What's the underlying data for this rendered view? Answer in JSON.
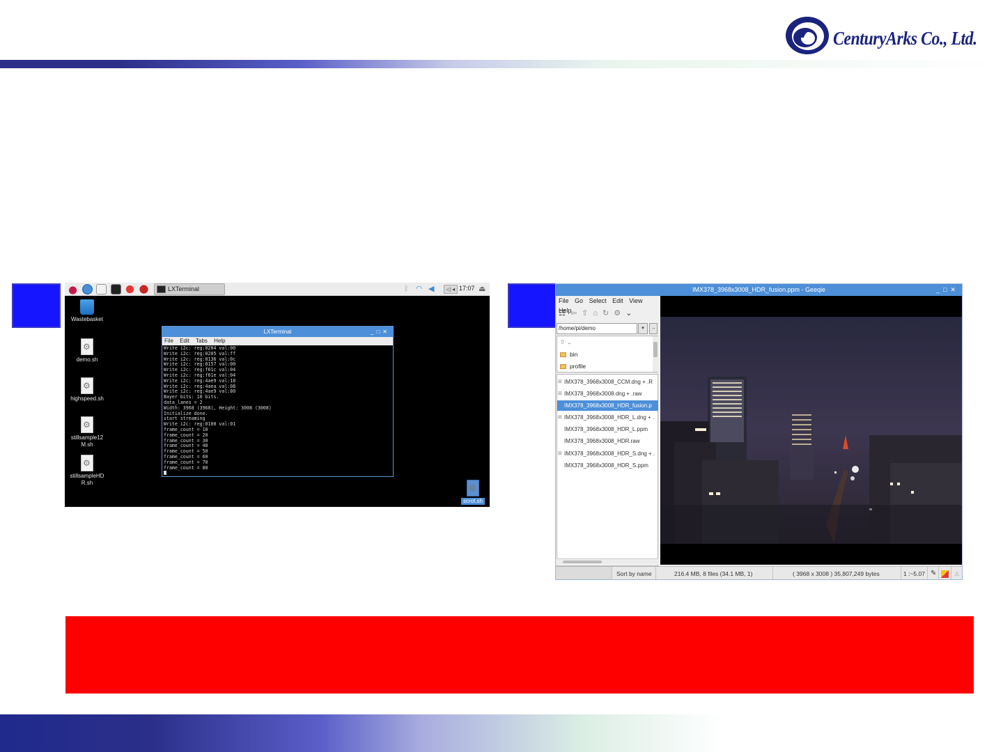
{
  "header": {
    "company": "CenturyArks Co., Ltd."
  },
  "left_screen": {
    "panel": {
      "task_label": "LXTerminal",
      "clock": "17:07",
      "tray_box": "◁ ◂"
    },
    "desktop_icons": [
      {
        "label": "Wastebasket"
      },
      {
        "label": "demo.sh"
      },
      {
        "label": "highspeed.sh"
      },
      {
        "label": "stillsample12\nM.sh"
      },
      {
        "label": "stillsampleHD\nR.sh"
      },
      {
        "label": "scrot.sh"
      }
    ],
    "terminal": {
      "title": "LXTerminal",
      "menu": [
        "File",
        "Edit",
        "Tabs",
        "Help"
      ],
      "output": "Write i2c: reg:0204 val:00\nWrite i2c: reg:0205 val:ff\nWrite i2c: reg:0136 val:0c\nWrite i2c: reg:0157 val:00\nWrite i2c: reg:f61c val:04\nWrite i2c: reg:f61e val:04\nWrite i2c: reg:4ae9 val:18\nWrite i2c: reg:4aea val:08\nWrite i2c: reg:4ae9 val:80\nBayer bits: 10 bits.\ndata_lanes = 2\nWidth: 3968 (3968), Height: 3008 (3008)\nInitialize done.\nstart streaming\nWrite i2c: reg:0100 val:01\nframe_count = 10\nframe_count = 20\nframe_count = 30\nframe_count = 40\nframe_count = 50\nframe_count = 60\nframe_count = 70\nframe_count = 80"
    }
  },
  "right_screen": {
    "title": "IMX378_3968x3008_HDR_fusion.ppm - Geeqie",
    "menu": [
      "File",
      "Go",
      "Select",
      "Edit",
      "View",
      "Help"
    ],
    "path": "/home/pi/demo",
    "dirs": [
      "..",
      "bin",
      "profile"
    ],
    "files": [
      {
        "name": "IMX378_3968x3008_CCM.dng + .R",
        "expander": true,
        "selected": false
      },
      {
        "name": "IMX378_3968x3008.dng + .raw",
        "expander": true,
        "selected": false
      },
      {
        "name": "IMX378_3968x3008_HDR_fusion.p",
        "expander": false,
        "selected": true
      },
      {
        "name": "IMX378_3968x3008_HDR_L.dng + .",
        "expander": true,
        "selected": false
      },
      {
        "name": "IMX378_3968x3008_HDR_L.ppm",
        "expander": false,
        "selected": false
      },
      {
        "name": "IMX378_3968x3008_HDR.raw",
        "expander": false,
        "selected": false
      },
      {
        "name": "IMX378_3968x3008_HDR_S.dng + .",
        "expander": true,
        "selected": false
      },
      {
        "name": "IMX378_3968x3008_HDR_S.ppm",
        "expander": false,
        "selected": false
      }
    ],
    "status": {
      "sort": "Sort by name",
      "summary": "216.4 MB, 8 files (34.1 MB, 1)",
      "image_info": "( 3968 x 3008 ) 35,807,249 bytes",
      "zoom": "1 :~5.07"
    }
  }
}
